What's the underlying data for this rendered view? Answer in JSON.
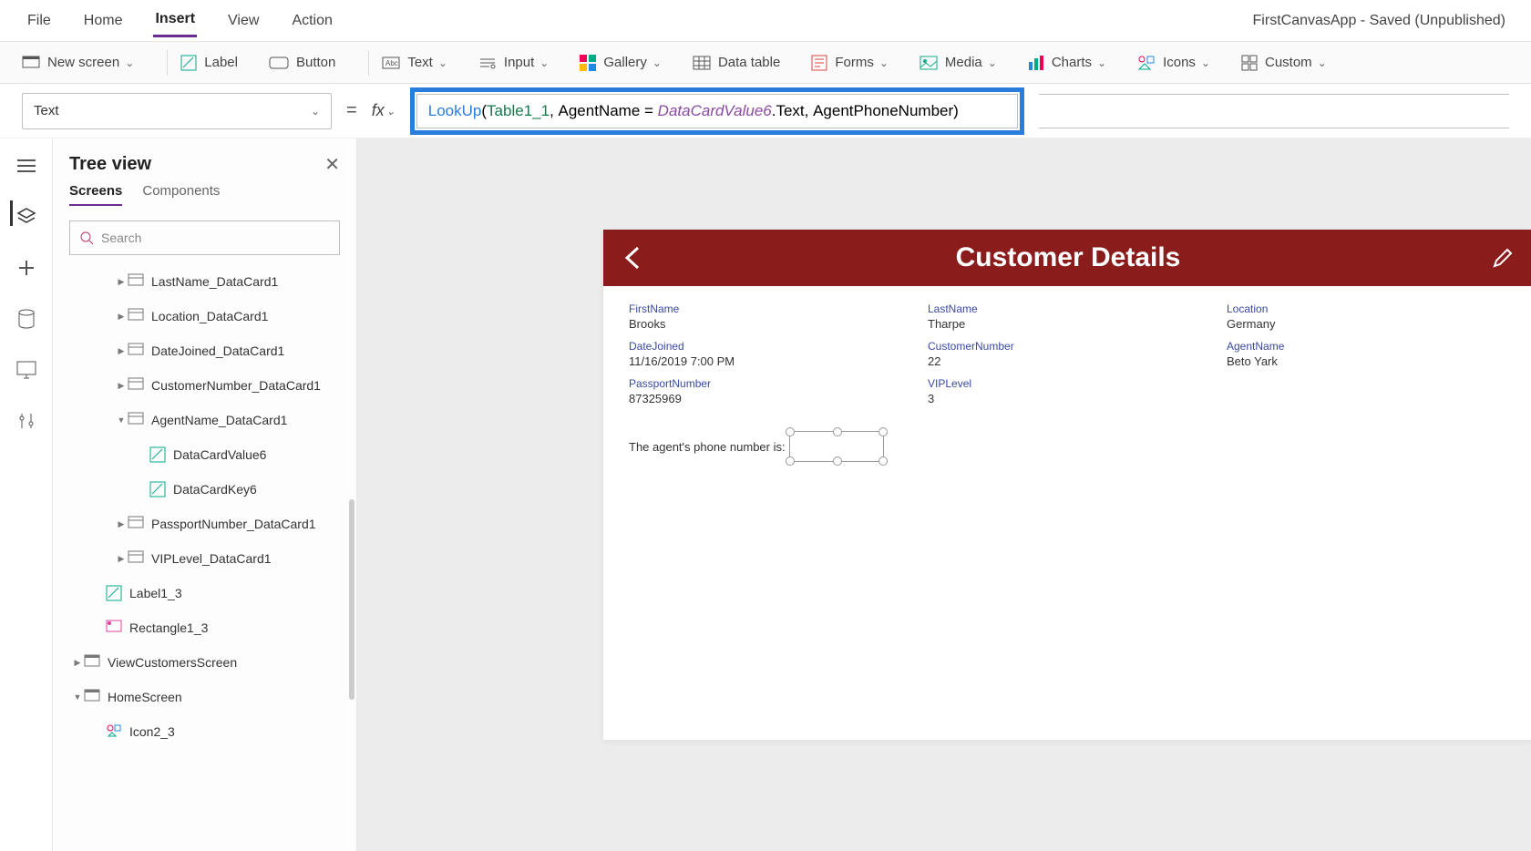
{
  "app_title": "FirstCanvasApp - Saved (Unpublished)",
  "menubar": [
    "File",
    "Home",
    "Insert",
    "View",
    "Action"
  ],
  "menubar_active": "Insert",
  "ribbon": {
    "new_screen": "New screen",
    "label": "Label",
    "button": "Button",
    "text": "Text",
    "input": "Input",
    "gallery": "Gallery",
    "data_table": "Data table",
    "forms": "Forms",
    "media": "Media",
    "charts": "Charts",
    "icons": "Icons",
    "custom": "Custom"
  },
  "property_selector": "Text",
  "formula": {
    "fn": "LookUp",
    "table": "Table1_1",
    "field_left": "AgentName",
    "ref": "DataCardValue6",
    "ref_suffix": ".Text",
    "out": "AgentPhoneNumber"
  },
  "sidebar": {
    "title": "Tree view",
    "tabs": [
      "Screens",
      "Components"
    ],
    "active_tab": "Screens",
    "search_placeholder": "Search",
    "items": [
      {
        "label": "LastName_DataCard1",
        "indent": 2,
        "icon": "card",
        "exp": ">"
      },
      {
        "label": "Location_DataCard1",
        "indent": 2,
        "icon": "card",
        "exp": ">"
      },
      {
        "label": "DateJoined_DataCard1",
        "indent": 2,
        "icon": "card",
        "exp": ">"
      },
      {
        "label": "CustomerNumber_DataCard1",
        "indent": 2,
        "icon": "card",
        "exp": ">"
      },
      {
        "label": "AgentName_DataCard1",
        "indent": 2,
        "icon": "card",
        "exp": "v"
      },
      {
        "label": "DataCardValue6",
        "indent": 3,
        "icon": "label",
        "exp": ""
      },
      {
        "label": "DataCardKey6",
        "indent": 3,
        "icon": "label",
        "exp": ""
      },
      {
        "label": "PassportNumber_DataCard1",
        "indent": 2,
        "icon": "card",
        "exp": ">"
      },
      {
        "label": "VIPLevel_DataCard1",
        "indent": 2,
        "icon": "card",
        "exp": ">"
      },
      {
        "label": "Label1_3",
        "indent": 1,
        "icon": "label",
        "exp": ""
      },
      {
        "label": "Rectangle1_3",
        "indent": 1,
        "icon": "rect",
        "exp": ""
      },
      {
        "label": "ViewCustomersScreen",
        "indent": 0,
        "icon": "screen",
        "exp": ">"
      },
      {
        "label": "HomeScreen",
        "indent": 0,
        "icon": "screen",
        "exp": "v"
      },
      {
        "label": "Icon2_3",
        "indent": 1,
        "icon": "iconsets",
        "exp": ""
      }
    ]
  },
  "canvas": {
    "title": "Customer Details",
    "fields": [
      {
        "label": "FirstName",
        "value": "Brooks"
      },
      {
        "label": "LastName",
        "value": "Tharpe"
      },
      {
        "label": "Location",
        "value": "Germany"
      },
      {
        "label": "DateJoined",
        "value": "11/16/2019 7:00 PM"
      },
      {
        "label": "CustomerNumber",
        "value": "22"
      },
      {
        "label": "AgentName",
        "value": "Beto Yark"
      },
      {
        "label": "PassportNumber",
        "value": "87325969"
      },
      {
        "label": "VIPLevel",
        "value": "3"
      }
    ],
    "agent_phone_label": "The agent's phone number is:"
  }
}
